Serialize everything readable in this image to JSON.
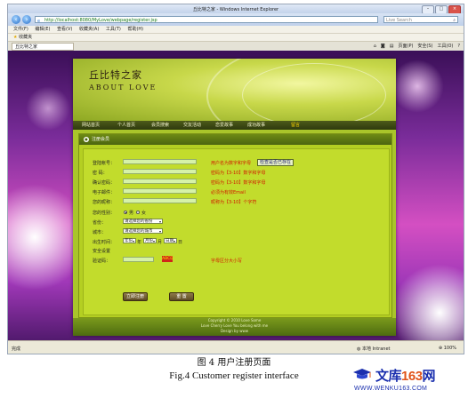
{
  "browser": {
    "window_title": "丘比特之家 - Windows Internet Explorer",
    "address": "http://localhost:8080/MyLove/webpage/register.jsp",
    "search_placeholder": "Live Search",
    "menu": [
      "文件(F)",
      "编辑(E)",
      "查看(V)",
      "收藏夹(A)",
      "工具(T)",
      "帮助(H)"
    ],
    "favorites_label": "收藏夹",
    "tab_title": "丘比特之家",
    "tab_tools": [
      "页面(P)",
      "安全(S)",
      "工具(O)"
    ],
    "status_text": "完成",
    "zone_text": "本地 Intranet",
    "zoom": "100%"
  },
  "site": {
    "title": "丘比特之家",
    "subtitle": "ABOUT LOVE",
    "nav": [
      "网站首页",
      "个人首页",
      "会员搜索",
      "交友活动",
      "恋爱故事",
      "成功故事",
      "留言"
    ],
    "active_nav_index": 6,
    "panel_title": "注册会员",
    "form": {
      "fields": [
        {
          "label": "登陆帐号：",
          "hint": "用户名为数字和字母",
          "action": "检查是否已存在"
        },
        {
          "label": "密    码：",
          "hint": "密码为【3-10】数字和字母"
        },
        {
          "label": "确认密码：",
          "hint": "密码为【3-10】数字和字母"
        },
        {
          "label": "电子邮件：",
          "hint": "必须为有效Email"
        },
        {
          "label": "您的昵称：",
          "hint": "昵称为【3-10】个字符"
        }
      ],
      "gender_label": "您的性别：",
      "gender_options": [
        "男",
        "女"
      ],
      "province_label": "省份：",
      "province_value": "请选择您的省份",
      "city_label": "城市：",
      "city_value": "请选择您的城市",
      "birthday_label": "出生时间：",
      "birthday_year": "年份",
      "birthday_year_unit": "年",
      "birthday_month": "月份",
      "birthday_month_unit": "月",
      "birthday_day": "日期",
      "birthday_day_unit": "日",
      "security_label": "安全设置",
      "captcha_label": "验证码：",
      "captcha_text": "ABCD",
      "captcha_hint": "字母区分大小写",
      "submit_label": "立即注册",
      "reset_label": "重 置"
    },
    "footer": [
      "Copyright © 2010 Love Some",
      "Love Cherry Love  You belong with me",
      "Design by www"
    ]
  },
  "captions": {
    "zh": "图 4  用户注册页面",
    "en": "Fig.4 Customer register interface"
  },
  "watermark": {
    "brand_text": "文库",
    "brand_num": "163",
    "brand_suffix": "网",
    "url": "WWW.WENKU163.COM"
  },
  "colors": {
    "form_green": "#c2dc2c",
    "hint_red": "#d11a00",
    "nav_active": "#ffd400"
  }
}
